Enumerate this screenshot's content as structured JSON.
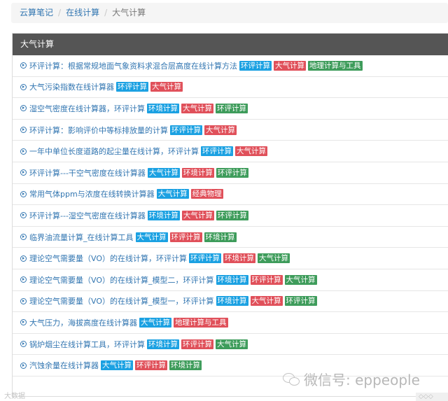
{
  "breadcrumb": {
    "items": [
      "云算笔记",
      "在线计算",
      "大气计算"
    ],
    "separator": "/"
  },
  "panel": {
    "heading": "大气计算",
    "items": [
      {
        "title": "环评计算：根据常规地面气象资料求混合层高度在线计算方法",
        "tags": [
          {
            "text": "环评计算",
            "color": "blue"
          },
          {
            "text": "大气计算",
            "color": "red"
          },
          {
            "text": "地理计算与工具",
            "color": "green"
          }
        ]
      },
      {
        "title": "大气污染指数在线计算器",
        "tags": [
          {
            "text": "环评计算",
            "color": "blue"
          },
          {
            "text": "大气计算",
            "color": "red"
          }
        ]
      },
      {
        "title": "湿空气密度在线计算器，环评计算",
        "tags": [
          {
            "text": "环境计算",
            "color": "blue"
          },
          {
            "text": "大气计算",
            "color": "red"
          },
          {
            "text": "环评计算",
            "color": "green"
          }
        ]
      },
      {
        "title": "环评计算：影响评价中等标排放量的计算",
        "tags": [
          {
            "text": "环评计算",
            "color": "blue"
          },
          {
            "text": "大气计算",
            "color": "red"
          }
        ]
      },
      {
        "title": "一年中单位长度道路的起尘量在线计算，环评计算",
        "tags": [
          {
            "text": "环评计算",
            "color": "blue"
          },
          {
            "text": "大气计算",
            "color": "red"
          }
        ]
      },
      {
        "title": "环评计算---干空气密度在线计算器",
        "tags": [
          {
            "text": "大气计算",
            "color": "blue"
          },
          {
            "text": "环境计算",
            "color": "red"
          },
          {
            "text": "环评计算",
            "color": "green"
          }
        ]
      },
      {
        "title": "常用气体ppm与浓度在线转换计算器",
        "tags": [
          {
            "text": "大气计算",
            "color": "blue"
          },
          {
            "text": "经典物理",
            "color": "red"
          }
        ]
      },
      {
        "title": "环评计算---湿空气密度在线计算器",
        "tags": [
          {
            "text": "环境计算",
            "color": "blue"
          },
          {
            "text": "大气计算",
            "color": "red"
          },
          {
            "text": "环评计算",
            "color": "green"
          }
        ]
      },
      {
        "title": "临界油流量计算_在线计算工具",
        "tags": [
          {
            "text": "大气计算",
            "color": "blue"
          },
          {
            "text": "环评计算",
            "color": "red"
          },
          {
            "text": "环境计算",
            "color": "green"
          }
        ]
      },
      {
        "title": "理论空气需要量（VO）的在线计算，环评计算",
        "tags": [
          {
            "text": "环评计算",
            "color": "blue"
          },
          {
            "text": "环境计算",
            "color": "red"
          },
          {
            "text": "大气计算",
            "color": "green"
          }
        ]
      },
      {
        "title": "理论空气需要量（VO）的在线计算_模型二，环评计算",
        "tags": [
          {
            "text": "环境计算",
            "color": "blue"
          },
          {
            "text": "环评计算",
            "color": "red"
          },
          {
            "text": "大气计算",
            "color": "green"
          }
        ]
      },
      {
        "title": "理论空气需要量（VO）的在线计算_模型一，环评计算",
        "tags": [
          {
            "text": "环境计算",
            "color": "blue"
          },
          {
            "text": "大气计算",
            "color": "red"
          },
          {
            "text": "环评计算",
            "color": "green"
          }
        ]
      },
      {
        "title": "大气压力，海拔高度在线计算器",
        "tags": [
          {
            "text": "大气计算",
            "color": "blue"
          },
          {
            "text": "地理计算与工具",
            "color": "red"
          }
        ]
      },
      {
        "title": "锅炉烟尘在线计算工具，环评计算",
        "tags": [
          {
            "text": "环境计算",
            "color": "blue"
          },
          {
            "text": "环评计算",
            "color": "red"
          },
          {
            "text": "大气计算",
            "color": "green"
          }
        ]
      },
      {
        "title": "汽蚀余量在线计算器",
        "tags": [
          {
            "text": "大气计算",
            "color": "blue"
          },
          {
            "text": "环评计算",
            "color": "red"
          },
          {
            "text": "环境计算",
            "color": "green"
          }
        ]
      }
    ]
  },
  "watermark": "微信号: eppeople",
  "footer": {
    "left": "大数据",
    "right": "◇◇◇"
  },
  "colors": {
    "blue": "#1ba1e2",
    "red": "#e0505a",
    "green": "#3e9c5b",
    "heading_bg": "#555555",
    "link": "#3276b1"
  }
}
